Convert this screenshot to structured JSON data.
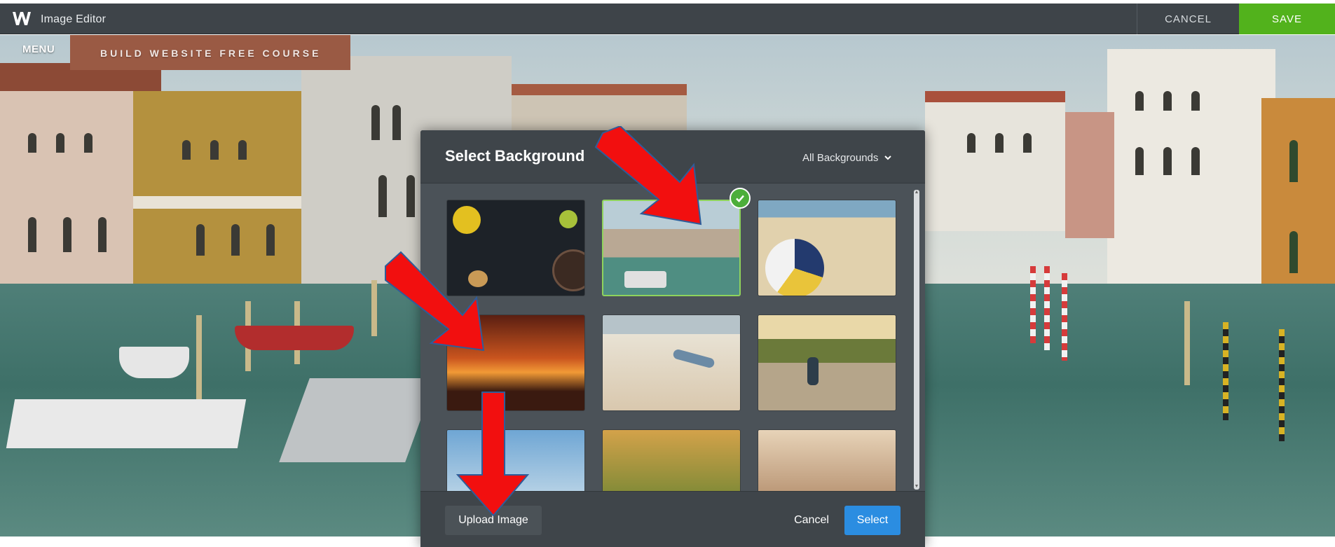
{
  "topbar": {
    "app_title": "Image Editor",
    "cancel_label": "CANCEL",
    "save_label": "SAVE",
    "logo_icon": "weebly-w-icon"
  },
  "site": {
    "menu_label": "MENU",
    "site_title": "BUILD WEBSITE FREE COURSE"
  },
  "modal": {
    "title": "Select Background",
    "filter_label": "All Backgrounds",
    "thumbnails": [
      {
        "subject": "dark table with lemons and cookies",
        "selected": false
      },
      {
        "subject": "venice canal",
        "selected": true
      },
      {
        "subject": "volleyball on beach",
        "selected": false
      },
      {
        "subject": "sunset cyclists",
        "selected": false
      },
      {
        "subject": "girl on swing at beach",
        "selected": false
      },
      {
        "subject": "cyclist on road",
        "selected": false
      },
      {
        "subject": "person by sea",
        "selected": false
      },
      {
        "subject": "mountain biker",
        "selected": false
      },
      {
        "subject": "biker on rocks",
        "selected": false
      }
    ],
    "upload_label": "Upload Image",
    "cancel_label": "Cancel",
    "select_label": "Select"
  },
  "colors": {
    "topbar_bg": "#3e4449",
    "save_green": "#52b21c",
    "select_blue": "#2b8de1",
    "arrow_red": "#f20f0f",
    "check_green": "#4cae3a"
  }
}
